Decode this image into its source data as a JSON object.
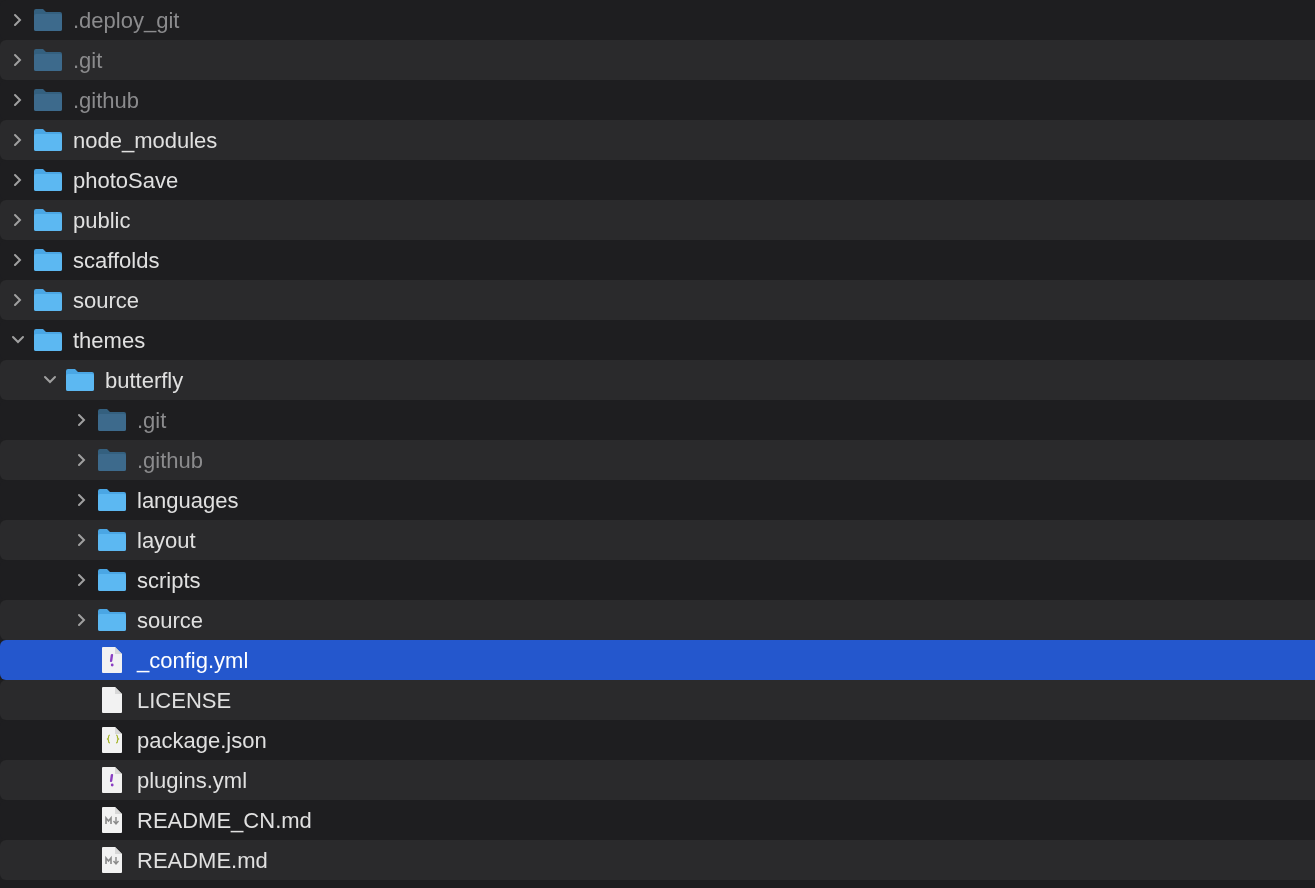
{
  "tree": [
    {
      "name": ".deploy_git",
      "kind": "folder",
      "hidden": true,
      "expanded": false,
      "selected": false
    },
    {
      "name": ".git",
      "kind": "folder",
      "hidden": true,
      "expanded": false,
      "selected": false
    },
    {
      "name": ".github",
      "kind": "folder",
      "hidden": true,
      "expanded": false,
      "selected": false
    },
    {
      "name": "node_modules",
      "kind": "folder",
      "hidden": false,
      "expanded": false,
      "selected": false
    },
    {
      "name": "photoSave",
      "kind": "folder",
      "hidden": false,
      "expanded": false,
      "selected": false
    },
    {
      "name": "public",
      "kind": "folder",
      "hidden": false,
      "expanded": false,
      "selected": false
    },
    {
      "name": "scaffolds",
      "kind": "folder",
      "hidden": false,
      "expanded": false,
      "selected": false
    },
    {
      "name": "source",
      "kind": "folder",
      "hidden": false,
      "expanded": false,
      "selected": false
    },
    {
      "name": "themes",
      "kind": "folder",
      "hidden": false,
      "expanded": true,
      "selected": false,
      "children": [
        {
          "name": "butterfly",
          "kind": "folder",
          "hidden": false,
          "expanded": true,
          "selected": false,
          "children": [
            {
              "name": ".git",
              "kind": "folder",
              "hidden": true,
              "expanded": false,
              "selected": false
            },
            {
              "name": ".github",
              "kind": "folder",
              "hidden": true,
              "expanded": false,
              "selected": false
            },
            {
              "name": "languages",
              "kind": "folder",
              "hidden": false,
              "expanded": false,
              "selected": false
            },
            {
              "name": "layout",
              "kind": "folder",
              "hidden": false,
              "expanded": false,
              "selected": false
            },
            {
              "name": "scripts",
              "kind": "folder",
              "hidden": false,
              "expanded": false,
              "selected": false
            },
            {
              "name": "source",
              "kind": "folder",
              "hidden": false,
              "expanded": false,
              "selected": false
            },
            {
              "name": "_config.yml",
              "kind": "yaml",
              "selected": true
            },
            {
              "name": "LICENSE",
              "kind": "plain",
              "selected": false
            },
            {
              "name": "package.json",
              "kind": "json",
              "selected": false
            },
            {
              "name": "plugins.yml",
              "kind": "yaml",
              "selected": false
            },
            {
              "name": "README_CN.md",
              "kind": "markdown",
              "selected": false
            },
            {
              "name": "README.md",
              "kind": "markdown",
              "selected": false
            }
          ]
        }
      ]
    }
  ]
}
